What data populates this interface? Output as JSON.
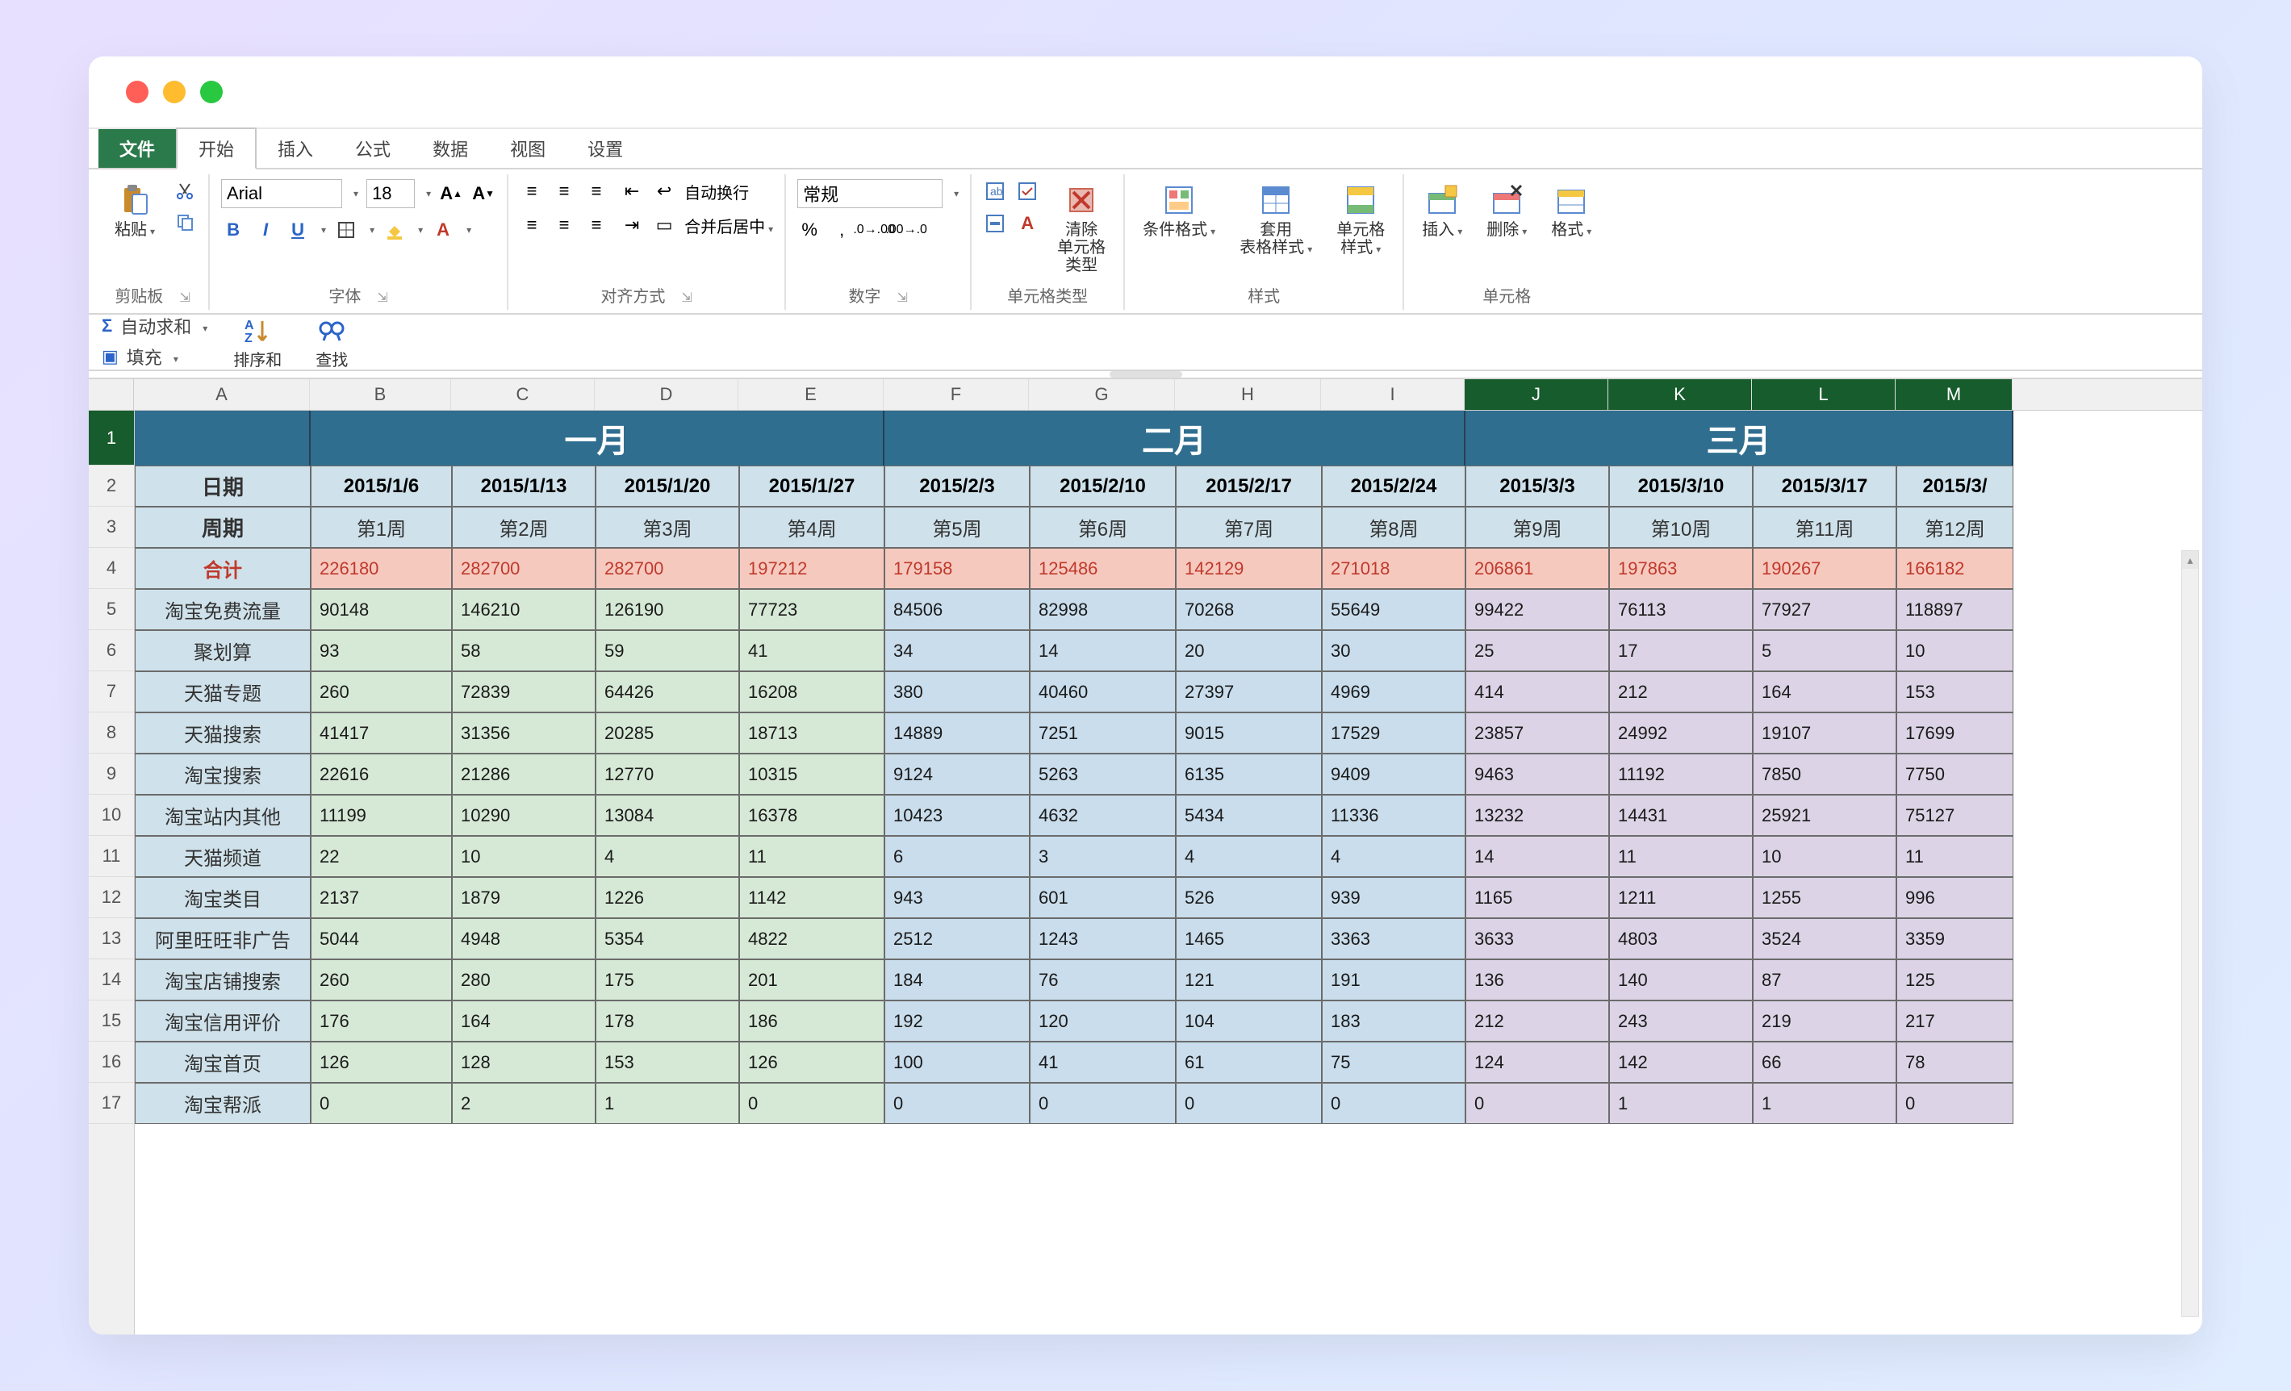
{
  "menutabs": {
    "file": "文件",
    "home": "开始",
    "insert": "插入",
    "formula": "公式",
    "data": "数据",
    "view": "视图",
    "settings": "设置"
  },
  "ribbon": {
    "clipboard": {
      "paste": "粘贴",
      "label": "剪贴板"
    },
    "font": {
      "name": "Arial",
      "size": "18",
      "label": "字体",
      "B": "B",
      "I": "I",
      "U": "U"
    },
    "align": {
      "label": "对齐方式",
      "wrap": "自动换行",
      "merge": "合并后居中"
    },
    "number": {
      "label": "数字",
      "format": "常规",
      "pct": "%",
      "comma": ",",
      "dec1": ".0",
      "dec2": ".00"
    },
    "celltype": {
      "label": "单元格类型",
      "clear": "清除\n单元格\n类型"
    },
    "styles": {
      "label": "样式",
      "cond": "条件格式",
      "tbl": "套用\n表格样式",
      "cell": "单元格\n样式"
    },
    "cells": {
      "label": "单元格",
      "ins": "插入",
      "del": "删除",
      "fmt": "格式"
    }
  },
  "ribbon2": {
    "autosum": "自动求和",
    "fill": "填充",
    "sort": "排序和",
    "find": "查找"
  },
  "columns": [
    "A",
    "B",
    "C",
    "D",
    "E",
    "F",
    "G",
    "H",
    "I",
    "J",
    "K",
    "L",
    "M"
  ],
  "months": {
    "jan": "一月",
    "feb": "二月",
    "mar": "三月"
  },
  "headerA": {
    "date": "日期",
    "week": "周期",
    "total": "合计"
  },
  "dates": [
    "2015/1/6",
    "2015/1/13",
    "2015/1/20",
    "2015/1/27",
    "2015/2/3",
    "2015/2/10",
    "2015/2/17",
    "2015/2/24",
    "2015/3/3",
    "2015/3/10",
    "2015/3/17",
    "2015/3/"
  ],
  "weeks": [
    "第1周",
    "第2周",
    "第3周",
    "第4周",
    "第5周",
    "第6周",
    "第7周",
    "第8周",
    "第9周",
    "第10周",
    "第11周",
    "第12周"
  ],
  "rowLabels": [
    "淘宝免费流量",
    "聚划算",
    "天猫专题",
    "天猫搜索",
    "淘宝搜索",
    "淘宝站内其他",
    "天猫频道",
    "淘宝类目",
    "阿里旺旺非广告",
    "淘宝店铺搜索",
    "淘宝信用评价",
    "淘宝首页",
    "淘宝帮派"
  ],
  "totals": [
    "226180",
    "282700",
    "282700",
    "197212",
    "179158",
    "125486",
    "142129",
    "271018",
    "206861",
    "197863",
    "190267",
    "166182"
  ],
  "rows": [
    [
      "90148",
      "146210",
      "126190",
      "77723",
      "84506",
      "82998",
      "70268",
      "55649",
      "99422",
      "76113",
      "77927",
      "118897"
    ],
    [
      "93",
      "58",
      "59",
      "41",
      "34",
      "14",
      "20",
      "30",
      "25",
      "17",
      "5",
      "10"
    ],
    [
      "260",
      "72839",
      "64426",
      "16208",
      "380",
      "40460",
      "27397",
      "4969",
      "414",
      "212",
      "164",
      "153"
    ],
    [
      "41417",
      "31356",
      "20285",
      "18713",
      "14889",
      "7251",
      "9015",
      "17529",
      "23857",
      "24992",
      "19107",
      "17699"
    ],
    [
      "22616",
      "21286",
      "12770",
      "10315",
      "9124",
      "5263",
      "6135",
      "9409",
      "9463",
      "11192",
      "7850",
      "7750"
    ],
    [
      "11199",
      "10290",
      "13084",
      "16378",
      "10423",
      "4632",
      "5434",
      "11336",
      "13232",
      "14431",
      "25921",
      "75127"
    ],
    [
      "22",
      "10",
      "4",
      "11",
      "6",
      "3",
      "4",
      "4",
      "14",
      "11",
      "10",
      "11"
    ],
    [
      "2137",
      "1879",
      "1226",
      "1142",
      "943",
      "601",
      "526",
      "939",
      "1165",
      "1211",
      "1255",
      "996"
    ],
    [
      "5044",
      "4948",
      "5354",
      "4822",
      "2512",
      "1243",
      "1465",
      "3363",
      "3633",
      "4803",
      "3524",
      "3359"
    ],
    [
      "260",
      "280",
      "175",
      "201",
      "184",
      "76",
      "121",
      "191",
      "136",
      "140",
      "87",
      "125"
    ],
    [
      "176",
      "164",
      "178",
      "186",
      "192",
      "120",
      "104",
      "183",
      "212",
      "243",
      "219",
      "217"
    ],
    [
      "126",
      "128",
      "153",
      "126",
      "100",
      "41",
      "61",
      "75",
      "124",
      "142",
      "66",
      "78"
    ],
    [
      "0",
      "2",
      "1",
      "0",
      "0",
      "0",
      "0",
      "0",
      "0",
      "1",
      "1",
      "0"
    ]
  ]
}
